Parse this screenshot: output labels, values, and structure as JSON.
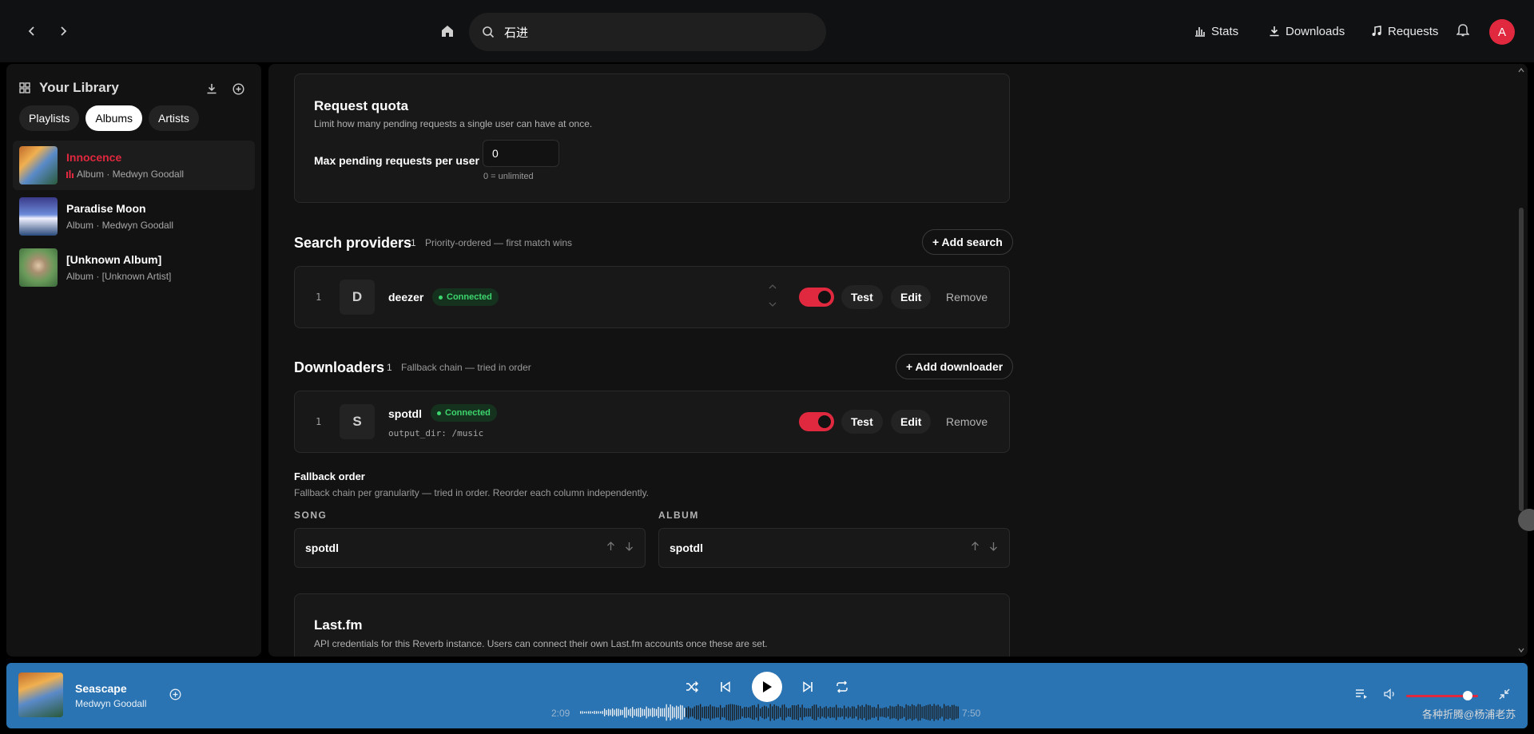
{
  "header": {
    "search_value": "石进",
    "stats_label": "Stats",
    "downloads_label": "Downloads",
    "requests_label": "Requests",
    "avatar_letter": "A"
  },
  "sidebar": {
    "title": "Your Library",
    "chips": [
      "Playlists",
      "Albums",
      "Artists"
    ],
    "active_chip": "Albums",
    "items": [
      {
        "title": "Innocence",
        "subtitle": "Album · Medwyn Goodall",
        "playing": true
      },
      {
        "title": "Paradise Moon",
        "subtitle": "Album · Medwyn Goodall"
      },
      {
        "title": "[Unknown Album]",
        "subtitle": "Album · [Unknown Artist]"
      }
    ]
  },
  "quota": {
    "title": "Request quota",
    "description": "Limit how many pending requests a single user can have at once.",
    "field_label": "Max pending requests per user",
    "field_value": "0",
    "hint": "0 = unlimited"
  },
  "search_providers": {
    "title": "Search providers",
    "count": "1",
    "note": "Priority-ordered — first match wins",
    "add_label": "+ Add search",
    "items": [
      {
        "index": "1",
        "letter": "D",
        "name": "deezer",
        "status": "Connected",
        "enabled": true
      }
    ]
  },
  "downloaders": {
    "title": "Downloaders",
    "count": "1",
    "note": "Fallback chain — tried in order",
    "add_label": "+ Add downloader",
    "items": [
      {
        "index": "1",
        "letter": "S",
        "name": "spotdl",
        "status": "Connected",
        "config": "output_dir: /music",
        "enabled": true
      }
    ]
  },
  "actions": {
    "test": "Test",
    "edit": "Edit",
    "remove": "Remove"
  },
  "fallback": {
    "title": "Fallback order",
    "description": "Fallback chain per granularity — tried in order. Reorder each column independently.",
    "columns": [
      {
        "header": "SONG",
        "value": "spotdl"
      },
      {
        "header": "ALBUM",
        "value": "spotdl"
      }
    ]
  },
  "lastfm": {
    "title": "Last.fm",
    "description": "API credentials for this Reverb instance. Users can connect their own Last.fm accounts once these are set."
  },
  "player": {
    "title": "Seascape",
    "artist": "Medwyn Goodall",
    "elapsed": "2:09",
    "duration": "7:50",
    "progress": 0.275,
    "volume": 0.85
  },
  "watermark": "各种折腾@杨浦老苏",
  "colors": {
    "accent": "#e0283e",
    "player_bg": "#2b74b3",
    "connected_green": "#3dd56d"
  }
}
